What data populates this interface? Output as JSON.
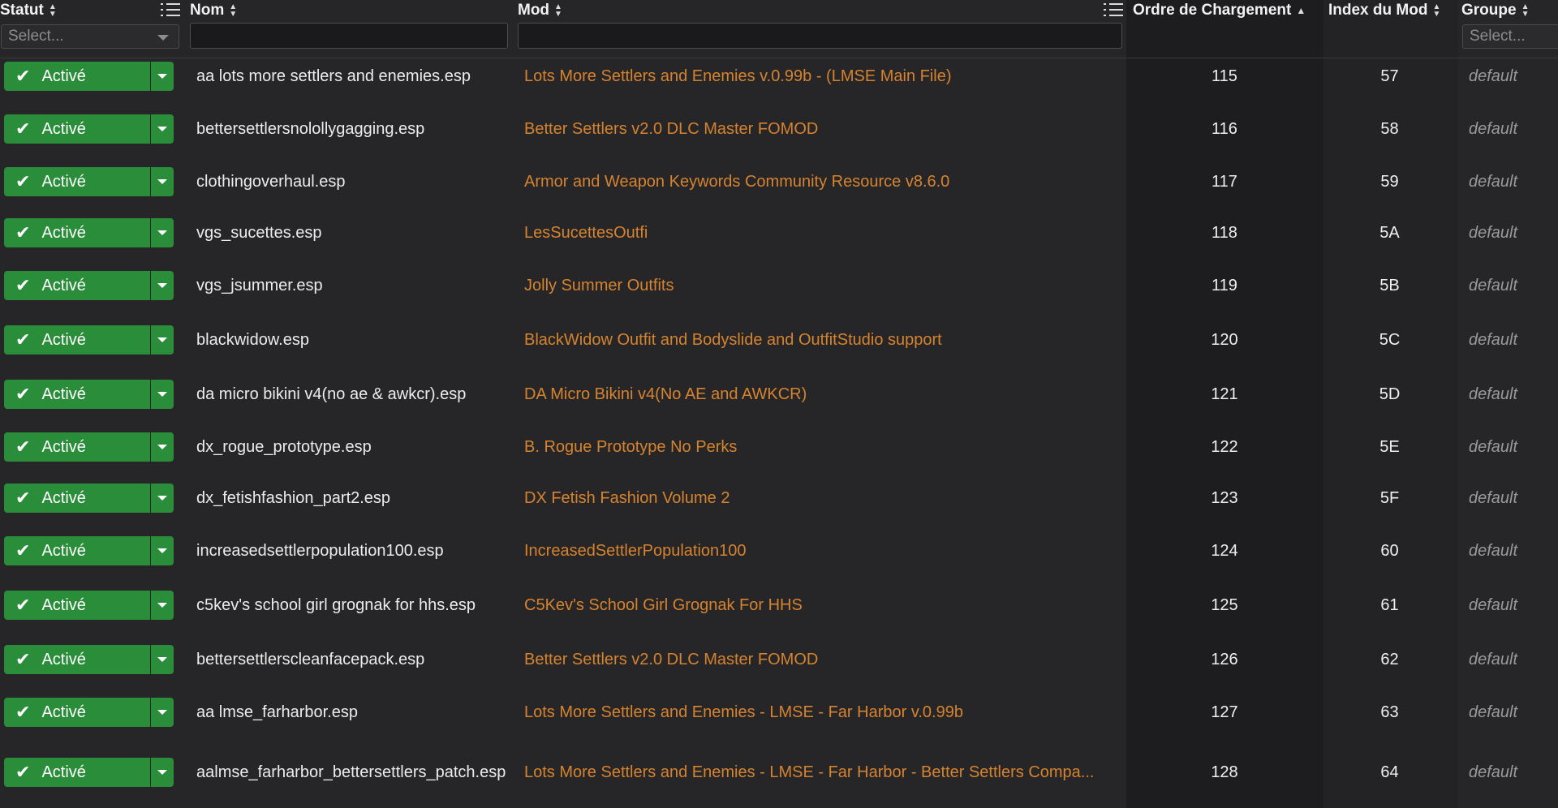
{
  "columns": {
    "statut": "Statut",
    "nom": "Nom",
    "mod": "Mod",
    "ordre": "Ordre de Chargement",
    "index": "Index du Mod",
    "groupe": "Groupe"
  },
  "filters": {
    "statut_placeholder": "Select...",
    "groupe_placeholder": "Select...",
    "nom_value": "",
    "mod_value": ""
  },
  "status_label": "Activé",
  "colors": {
    "active_green": "#2a8d3a",
    "mod_link": "#d6832f",
    "background": "#262628"
  },
  "rows": [
    {
      "status": "Activé",
      "name": "aa lots more settlers and enemies.esp",
      "mod": "Lots More Settlers and Enemies v.0.99b - (LMSE Main File)",
      "ordre": "115",
      "index": "57",
      "groupe": "default"
    },
    {
      "status": "Activé",
      "name": "bettersettlersnolollygagging.esp",
      "mod": "Better Settlers v2.0 DLC Master FOMOD",
      "ordre": "116",
      "index": "58",
      "groupe": "default"
    },
    {
      "status": "Activé",
      "name": "clothingoverhaul.esp",
      "mod": "Armor and Weapon Keywords Community Resource v8.6.0",
      "ordre": "117",
      "index": "59",
      "groupe": "default"
    },
    {
      "status": "Activé",
      "name": "vgs_sucettes.esp",
      "mod": "LesSucettesOutfi",
      "ordre": "118",
      "index": "5A",
      "groupe": "default"
    },
    {
      "status": "Activé",
      "name": "vgs_jsummer.esp",
      "mod": "Jolly Summer Outfits",
      "ordre": "119",
      "index": "5B",
      "groupe": "default"
    },
    {
      "status": "Activé",
      "name": "blackwidow.esp",
      "mod": "BlackWidow Outfit and Bodyslide and OutfitStudio support",
      "ordre": "120",
      "index": "5C",
      "groupe": "default"
    },
    {
      "status": "Activé",
      "name": "da micro bikini v4(no ae & awkcr).esp",
      "mod": "DA Micro Bikini v4(No AE and AWKCR)",
      "ordre": "121",
      "index": "5D",
      "groupe": "default"
    },
    {
      "status": "Activé",
      "name": "dx_rogue_prototype.esp",
      "mod": "B. Rogue Prototype No Perks",
      "ordre": "122",
      "index": "5E",
      "groupe": "default"
    },
    {
      "status": "Activé",
      "name": "dx_fetishfashion_part2.esp",
      "mod": "DX Fetish Fashion Volume 2",
      "ordre": "123",
      "index": "5F",
      "groupe": "default"
    },
    {
      "status": "Activé",
      "name": "increasedsettlerpopulation100.esp",
      "mod": "IncreasedSettlerPopulation100",
      "ordre": "124",
      "index": "60",
      "groupe": "default"
    },
    {
      "status": "Activé",
      "name": "c5kev's school girl grognak for hhs.esp",
      "mod": "C5Kev's School Girl Grognak For HHS",
      "ordre": "125",
      "index": "61",
      "groupe": "default"
    },
    {
      "status": "Activé",
      "name": "bettersettlerscleanfacepack.esp",
      "mod": "Better Settlers v2.0 DLC Master FOMOD",
      "ordre": "126",
      "index": "62",
      "groupe": "default"
    },
    {
      "status": "Activé",
      "name": "aa lmse_farharbor.esp",
      "mod": "Lots More Settlers and Enemies - LMSE - Far Harbor v.0.99b",
      "ordre": "127",
      "index": "63",
      "groupe": "default"
    },
    {
      "status": "Activé",
      "name": "aa\nlmse_farharbor_bettersettlers_patch.esp",
      "mod": "Lots More Settlers and Enemies - LMSE - Far Harbor - Better Settlers Compa...",
      "ordre": "128",
      "index": "64",
      "groupe": "default"
    }
  ]
}
